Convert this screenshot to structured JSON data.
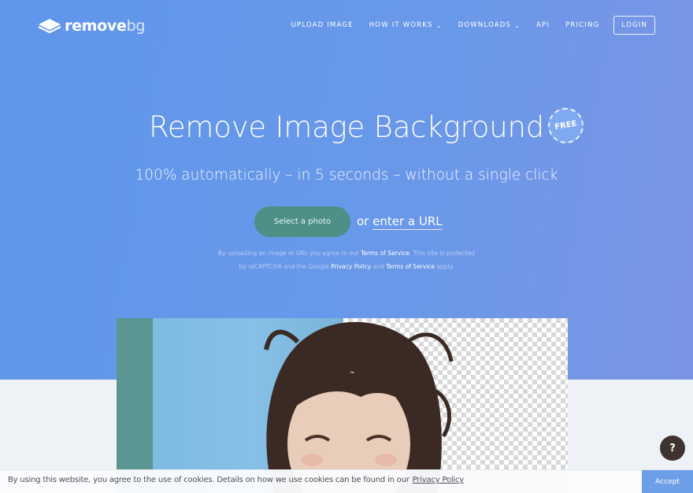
{
  "logo": {
    "word_main": "remove",
    "word_accent": "bg"
  },
  "nav": {
    "items": [
      {
        "label": "UPLOAD IMAGE",
        "dropdown": false
      },
      {
        "label": "HOW IT WORKS",
        "dropdown": true
      },
      {
        "label": "DOWNLOADS",
        "dropdown": true
      },
      {
        "label": "API",
        "dropdown": false
      },
      {
        "label": "PRICING",
        "dropdown": false
      }
    ],
    "login": "LOGIN",
    "chevron": "⌄"
  },
  "hero": {
    "title": "Remove Image Background",
    "badge": "FREE",
    "subtitle": "100% automatically – in 5 seconds – without a single click",
    "select_button": "Select a photo",
    "or_text": "or",
    "url_link": "enter a URL",
    "legal": {
      "part1": "By uploading an image or URL you agree to our",
      "terms1": "Terms of Service",
      "part2": ". This site is protected",
      "part3": "by reCAPTCHA and the Google",
      "privacy": "Privacy Policy",
      "part4": "and",
      "terms2": "Terms of Service",
      "part5": "apply."
    }
  },
  "help": {
    "label": "?"
  },
  "cookie": {
    "text": "By using this website, you agree to the use of cookies. Details on how we use cookies can be found in our",
    "link": "Privacy Policy",
    "accept": "Accept"
  },
  "colors": {
    "hero_start": "#5f96ea",
    "hero_end": "#7b95e4",
    "select_button": "#4e9087",
    "accept_button": "#6d9fe8"
  }
}
